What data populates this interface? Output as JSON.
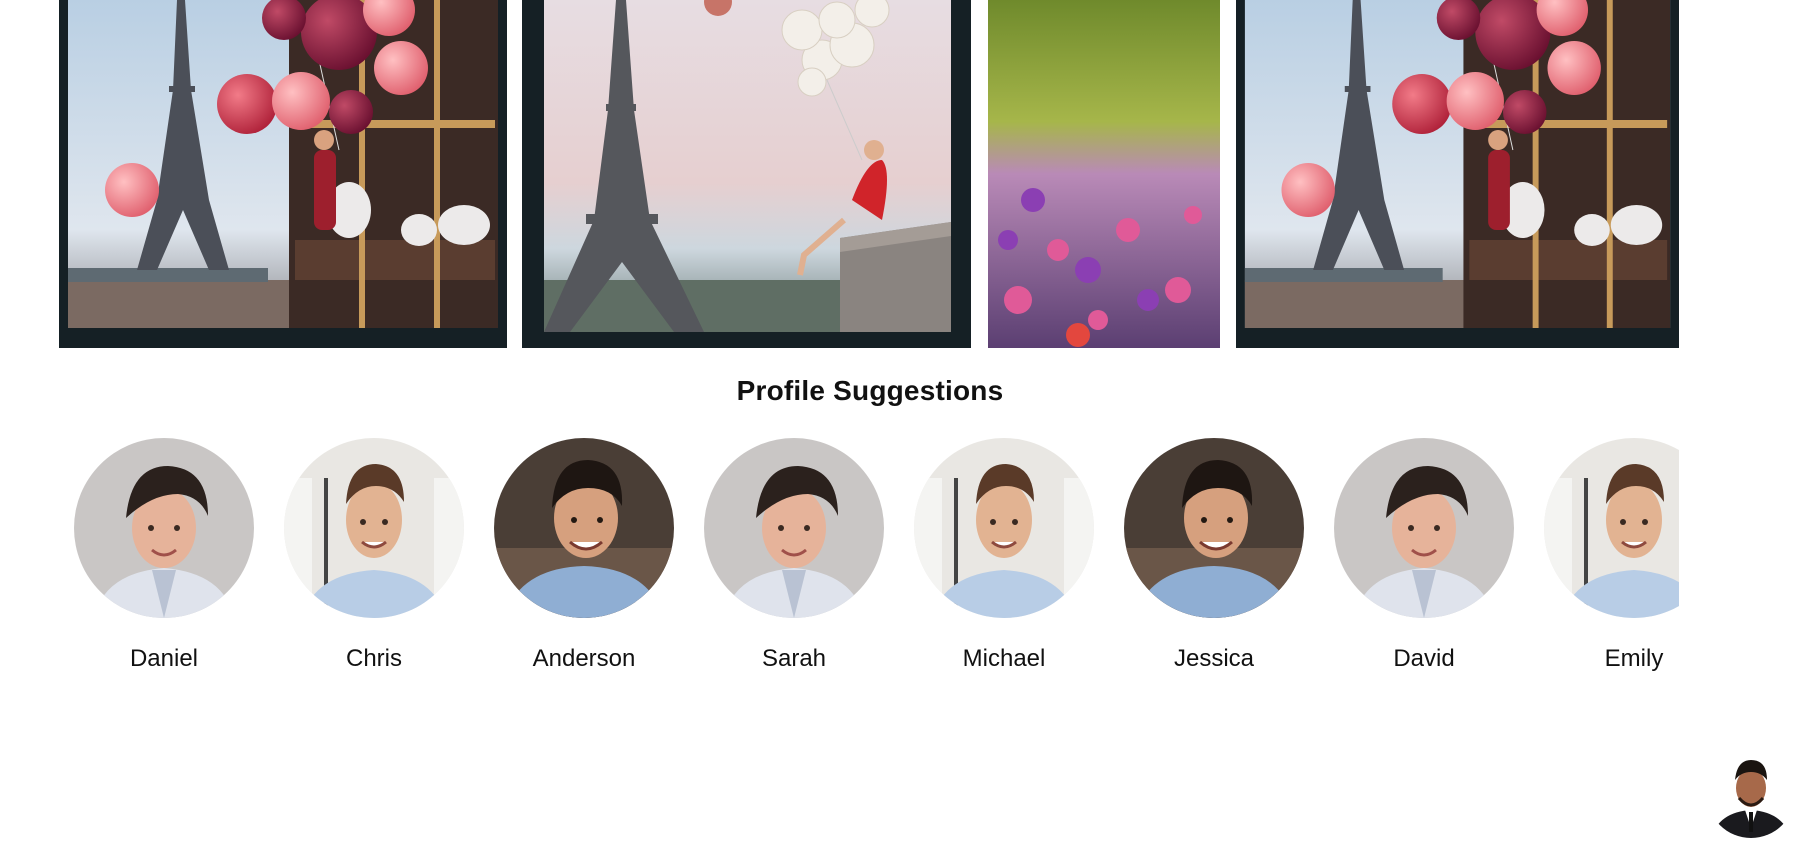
{
  "gallery": {
    "posts": [
      {
        "image": "eiffel-carousel-balloons-photo"
      },
      {
        "image": "eiffel-woman-balloons-photo"
      },
      {
        "image": "flower-field-photo"
      },
      {
        "image": "eiffel-carousel-balloons-photo"
      }
    ]
  },
  "suggestions": {
    "title": "Profile Suggestions",
    "profiles": [
      {
        "name": "Daniel",
        "photo": "portrait-a"
      },
      {
        "name": "Chris",
        "photo": "portrait-b"
      },
      {
        "name": "Anderson",
        "photo": "portrait-c"
      },
      {
        "name": "Sarah",
        "photo": "portrait-a"
      },
      {
        "name": "Michael",
        "photo": "portrait-b"
      },
      {
        "name": "Jessica",
        "photo": "portrait-c"
      },
      {
        "name": "David",
        "photo": "portrait-a"
      },
      {
        "name": "Emily",
        "photo": "portrait-b"
      }
    ]
  },
  "current_user": {
    "photo": "user-avatar"
  }
}
